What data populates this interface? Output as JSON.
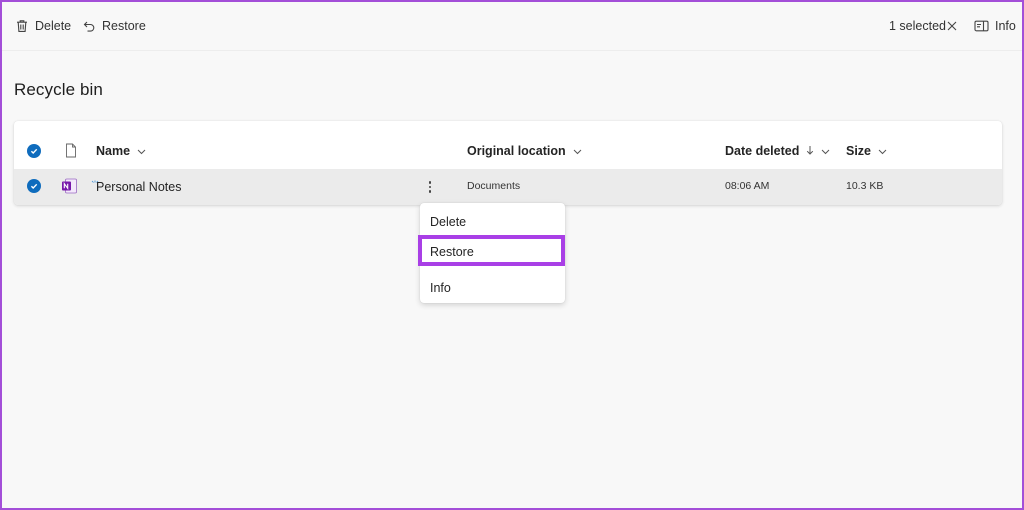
{
  "toolbar": {
    "delete_label": "Delete",
    "restore_label": "Restore",
    "selection_count": "1 selected",
    "info_label": "Info"
  },
  "page": {
    "title": "Recycle bin"
  },
  "table": {
    "columns": {
      "name": "Name",
      "original_location": "Original location",
      "date_deleted": "Date deleted",
      "size": "Size"
    },
    "sort": {
      "column": "date_deleted",
      "direction": "descending"
    },
    "rows": [
      {
        "name": "Personal Notes",
        "file_type_icon": "onenote-icon",
        "original_location": "Documents",
        "date_deleted": "08:06 AM",
        "size": "10.3 KB",
        "selected": true
      }
    ]
  },
  "context_menu": {
    "items": [
      "Delete",
      "Restore",
      "Info"
    ],
    "highlighted": "Restore"
  },
  "colors": {
    "accent": "#0f6cbd",
    "highlight_border": "#a93fe6",
    "onenote": "#7719aa",
    "selected_row": "#ebebeb"
  }
}
